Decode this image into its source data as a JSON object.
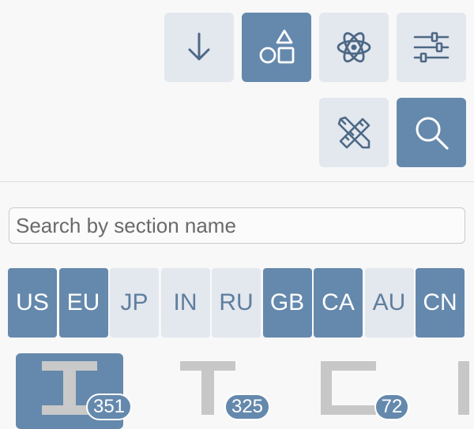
{
  "toolbar": {
    "buttons": [
      {
        "name": "download",
        "icon": "down-arrow-icon",
        "active": false
      },
      {
        "name": "shapes",
        "icon": "shapes-icon",
        "active": true
      },
      {
        "name": "materials",
        "icon": "atom-icon",
        "active": false
      },
      {
        "name": "settings",
        "icon": "sliders-icon",
        "active": false
      },
      {
        "name": "design",
        "icon": "pencil-ruler-icon",
        "active": false
      },
      {
        "name": "search",
        "icon": "magnifier-icon",
        "active": true
      }
    ]
  },
  "search": {
    "placeholder": "Search by section name",
    "value": ""
  },
  "regions": [
    {
      "code": "US",
      "selected": true
    },
    {
      "code": "EU",
      "selected": true
    },
    {
      "code": "JP",
      "selected": false
    },
    {
      "code": "IN",
      "selected": false
    },
    {
      "code": "RU",
      "selected": false
    },
    {
      "code": "GB",
      "selected": true
    },
    {
      "code": "CA",
      "selected": true
    },
    {
      "code": "AU",
      "selected": false
    },
    {
      "code": "CN",
      "selected": true
    }
  ],
  "shapes": [
    {
      "name": "i-beam",
      "icon": "i-beam-icon",
      "count": "351",
      "active": true
    },
    {
      "name": "t-section",
      "icon": "t-section-icon",
      "count": "325",
      "active": false
    },
    {
      "name": "channel",
      "icon": "channel-icon",
      "count": "72",
      "active": false
    },
    {
      "name": "angle",
      "icon": "angle-icon",
      "count": "",
      "active": false
    }
  ],
  "colors": {
    "accent": "#6589ad",
    "button_bg": "#e3e7ee",
    "icon_dark": "#4d6885",
    "shape_gray": "#c7c7c7",
    "background": "#f8f8f8"
  }
}
